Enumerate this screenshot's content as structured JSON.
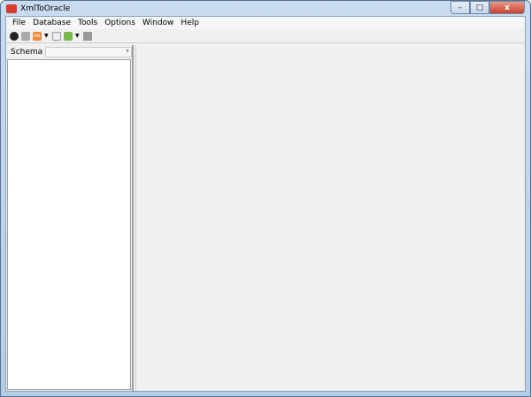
{
  "window": {
    "title": "XmlToOracle",
    "controls": {
      "minimize": "–",
      "maximize": "□",
      "close": "x"
    }
  },
  "menu": [
    "File",
    "Database",
    "Tools",
    "Options",
    "Window",
    "Help"
  ],
  "toolbar": {
    "icons": [
      "connect-icon",
      "disconnect-icon",
      "xml-icon",
      "dropdown-arrow",
      "import-icon",
      "export-icon",
      "dropdown-arrow",
      "stop-icon"
    ],
    "xml_label": "XML"
  },
  "left_panel": {
    "schema_label": "Schema",
    "schema_value": ""
  }
}
